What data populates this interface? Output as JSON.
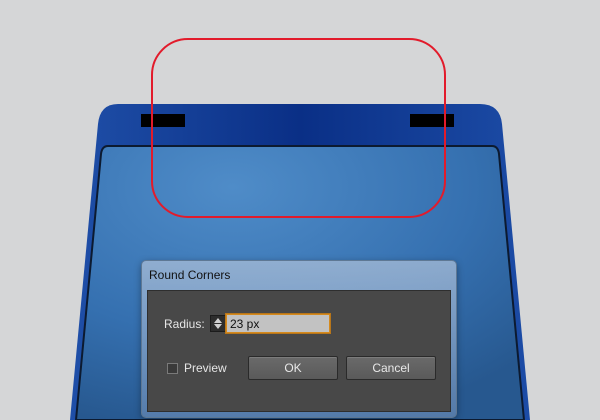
{
  "canvas": {
    "background": "#d5d6d7",
    "shape_fill": "#2f6db1",
    "shape_dark": "#05297a",
    "selection_color": "#e21b2b"
  },
  "dialog": {
    "title": "Round Corners",
    "radius_label": "Radius:",
    "radius_value": "23 px",
    "preview_label": "Preview",
    "preview_checked": false,
    "ok_label": "OK",
    "cancel_label": "Cancel"
  }
}
